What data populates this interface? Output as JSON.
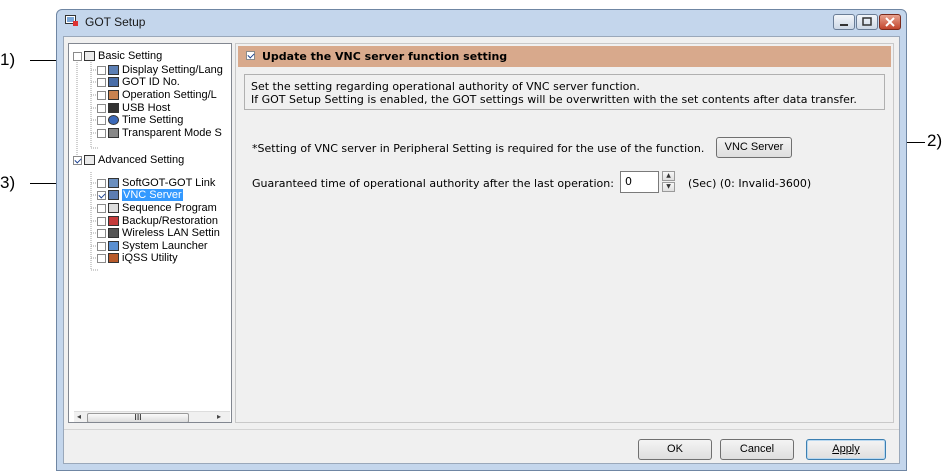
{
  "callouts": {
    "c1": "1)",
    "c2": "2)",
    "c3": "3)"
  },
  "window": {
    "title": "GOT Setup",
    "icon": "got-setup-icon"
  },
  "tree": {
    "items": [
      {
        "label": "Basic Setting",
        "icon": "basic-setting-icon",
        "checked": false
      },
      {
        "label": "Display Setting/Lang",
        "icon": "display-icon",
        "checked": false
      },
      {
        "label": "GOT ID No.",
        "icon": "id-icon",
        "checked": false
      },
      {
        "label": "Operation Setting/L",
        "icon": "operation-icon",
        "checked": false
      },
      {
        "label": "USB Host",
        "icon": "usb-icon",
        "checked": false
      },
      {
        "label": "Time Setting",
        "icon": "clock-icon",
        "checked": false
      },
      {
        "label": "Transparent Mode S",
        "icon": "transparent-icon",
        "checked": false
      },
      {
        "label": "Advanced Setting",
        "icon": "advanced-setting-icon",
        "checked": true
      },
      {
        "label": "SoftGOT-GOT Link",
        "icon": "link-icon",
        "checked": false
      },
      {
        "label": "VNC Server",
        "icon": "vnc-icon",
        "checked": true,
        "selected": true
      },
      {
        "label": "Sequence Program",
        "icon": "sequence-icon",
        "checked": false
      },
      {
        "label": "Backup/Restoration",
        "icon": "backup-icon",
        "checked": false
      },
      {
        "label": "Wireless LAN Settin",
        "icon": "wireless-icon",
        "checked": false
      },
      {
        "label": "System Launcher",
        "icon": "launcher-icon",
        "checked": false
      },
      {
        "label": "iQSS Utility",
        "icon": "iqss-icon",
        "checked": false
      }
    ],
    "scroll_left": "◂",
    "scroll_right": "▸",
    "scroll_thumb": "III"
  },
  "panel": {
    "header_label": "Update the VNC server function setting",
    "info_line1": "Set the setting regarding operational authority of VNC server function.",
    "info_line2": "If GOT Setup Setting is enabled, the GOT settings will be overwritten with the set contents after data transfer.",
    "note": "*Setting of VNC server in Peripheral Setting is required for the use of the function.",
    "vnc_button": "VNC Server",
    "guaranteed_label": "Guaranteed time of operational authority after the last operation:",
    "guaranteed_value": "0",
    "guaranteed_range": "(Sec) (0: Invalid-3600)"
  },
  "footer": {
    "ok": "OK",
    "cancel": "Cancel",
    "apply": "Apply"
  }
}
